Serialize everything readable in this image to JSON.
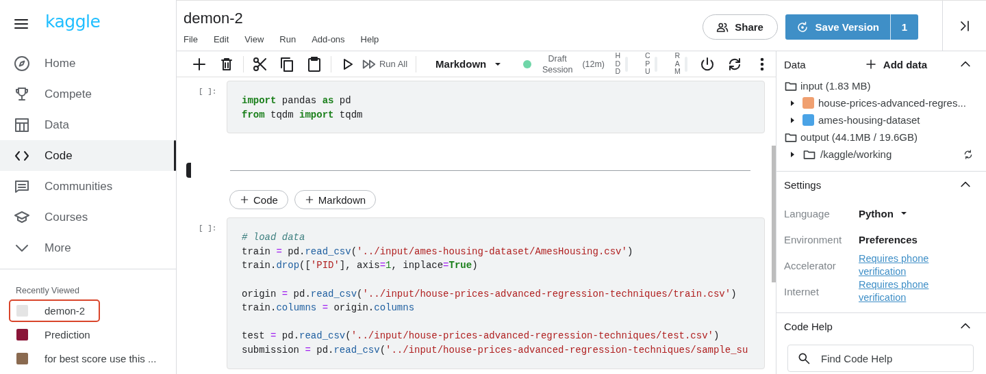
{
  "sidebar": {
    "logo": "kaggle",
    "nav": [
      {
        "label": "Home",
        "selected": false
      },
      {
        "label": "Compete",
        "selected": false
      },
      {
        "label": "Data",
        "selected": false
      },
      {
        "label": "Code",
        "selected": true
      },
      {
        "label": "Communities",
        "selected": false
      },
      {
        "label": "Courses",
        "selected": false
      },
      {
        "label": "More",
        "selected": false
      }
    ],
    "recent_title": "Recently Viewed",
    "recent": [
      {
        "label": "demon-2",
        "highlighted": true
      },
      {
        "label": "Prediction",
        "highlighted": false
      },
      {
        "label": "for best score use this ...",
        "highlighted": false
      }
    ]
  },
  "notebook": {
    "title": "demon-2",
    "menu": [
      "File",
      "Edit",
      "View",
      "Run",
      "Add-ons",
      "Help"
    ]
  },
  "actions": {
    "share": "Share",
    "save": "Save Version",
    "save_count": "1"
  },
  "toolbar": {
    "run_all": "Run All",
    "cell_type": "Markdown",
    "session_running": true,
    "session": "Draft Session",
    "session_time": "(12m)",
    "meters": [
      "HDD",
      "CPU",
      "RAM"
    ]
  },
  "cells": [
    {
      "kind": "code",
      "prompt": "[ ]:",
      "blocks": [
        [
          [
            {
              "kind": "kw",
              "t": "import"
            },
            {
              "kind": "p",
              "t": " pandas "
            },
            {
              "kind": "kw",
              "t": "as"
            },
            {
              "kind": "p",
              "t": " pd"
            }
          ],
          [
            {
              "kind": "kw",
              "t": "from"
            },
            {
              "kind": "p",
              "t": " tqdm "
            },
            {
              "kind": "kw",
              "t": "import"
            },
            {
              "kind": "p",
              "t": " tqdm"
            }
          ]
        ]
      ]
    },
    {
      "kind": "markdown",
      "selected": true
    },
    {
      "kind": "add",
      "buttons": [
        "Code",
        "Markdown"
      ]
    },
    {
      "kind": "code",
      "prompt": "[ ]:",
      "blocks": [
        [
          [
            {
              "kind": "cm",
              "t": "# load data"
            }
          ],
          [
            {
              "kind": "p",
              "t": "train "
            },
            {
              "kind": "op",
              "t": "="
            },
            {
              "kind": "p",
              "t": " pd."
            },
            {
              "kind": "fn",
              "t": "read_csv"
            },
            {
              "kind": "p",
              "t": "("
            },
            {
              "kind": "str",
              "t": "'../input/ames-housing-dataset/AmesHousing.csv'"
            },
            {
              "kind": "p",
              "t": ")"
            }
          ],
          [
            {
              "kind": "p",
              "t": "train."
            },
            {
              "kind": "fn",
              "t": "drop"
            },
            {
              "kind": "p",
              "t": "(["
            },
            {
              "kind": "str",
              "t": "'PID'"
            },
            {
              "kind": "p",
              "t": "], axis"
            },
            {
              "kind": "op",
              "t": "="
            },
            {
              "kind": "num",
              "t": "1"
            },
            {
              "kind": "p",
              "t": ", inplace"
            },
            {
              "kind": "op",
              "t": "="
            },
            {
              "kind": "kw",
              "t": "True"
            },
            {
              "kind": "p",
              "t": ")"
            }
          ]
        ],
        [
          [
            {
              "kind": "p",
              "t": "origin "
            },
            {
              "kind": "op",
              "t": "="
            },
            {
              "kind": "p",
              "t": " pd."
            },
            {
              "kind": "fn",
              "t": "read_csv"
            },
            {
              "kind": "p",
              "t": "("
            },
            {
              "kind": "str",
              "t": "'../input/house-prices-advanced-regression-techniques/train.csv'"
            },
            {
              "kind": "p",
              "t": ")"
            }
          ],
          [
            {
              "kind": "p",
              "t": "train."
            },
            {
              "kind": "fn",
              "t": "columns"
            },
            {
              "kind": "op",
              "t": " ="
            },
            {
              "kind": "p",
              "t": " origin."
            },
            {
              "kind": "fn",
              "t": "columns"
            }
          ]
        ],
        [
          [
            {
              "kind": "p",
              "t": "test "
            },
            {
              "kind": "op",
              "t": "="
            },
            {
              "kind": "p",
              "t": " pd."
            },
            {
              "kind": "fn",
              "t": "read_csv"
            },
            {
              "kind": "p",
              "t": "("
            },
            {
              "kind": "str",
              "t": "'../input/house-prices-advanced-regression-techniques/test.csv'"
            },
            {
              "kind": "p",
              "t": ")"
            }
          ],
          [
            {
              "kind": "p",
              "t": "submission "
            },
            {
              "kind": "op",
              "t": "="
            },
            {
              "kind": "p",
              "t": " pd."
            },
            {
              "kind": "fn",
              "t": "read_csv"
            },
            {
              "kind": "p",
              "t": "("
            },
            {
              "kind": "str",
              "t": "'../input/house-prices-advanced-regression-techniques/sample_su"
            }
          ]
        ]
      ]
    }
  ],
  "panel": {
    "data": {
      "title": "Data",
      "add": "Add data",
      "expanded": true,
      "tree": [
        {
          "label": "input (1.83 MB)",
          "children": [
            {
              "label": "house-prices-advanced-regres...",
              "kind": "competition",
              "expanded": false
            },
            {
              "label": "ames-housing-dataset",
              "kind": "dataset",
              "expanded": false
            }
          ]
        },
        {
          "label": "output (44.1MB / 19.6GB)",
          "children": [
            {
              "label": "/kaggle/working",
              "kind": "folder",
              "expanded": false
            }
          ]
        }
      ]
    },
    "settings": {
      "title": "Settings",
      "expanded": true,
      "rows": [
        {
          "label": "Language",
          "value": "Python",
          "kind": "dropdown"
        },
        {
          "label": "Environment",
          "value": "Preferences",
          "kind": "bold"
        },
        {
          "label": "Accelerator",
          "value": "Requires phone verification",
          "kind": "link"
        },
        {
          "label": "Internet",
          "value": "Requires phone verification",
          "kind": "link"
        }
      ]
    },
    "code_help": {
      "title": "Code Help",
      "expanded": true,
      "placeholder": "Find Code Help"
    }
  }
}
